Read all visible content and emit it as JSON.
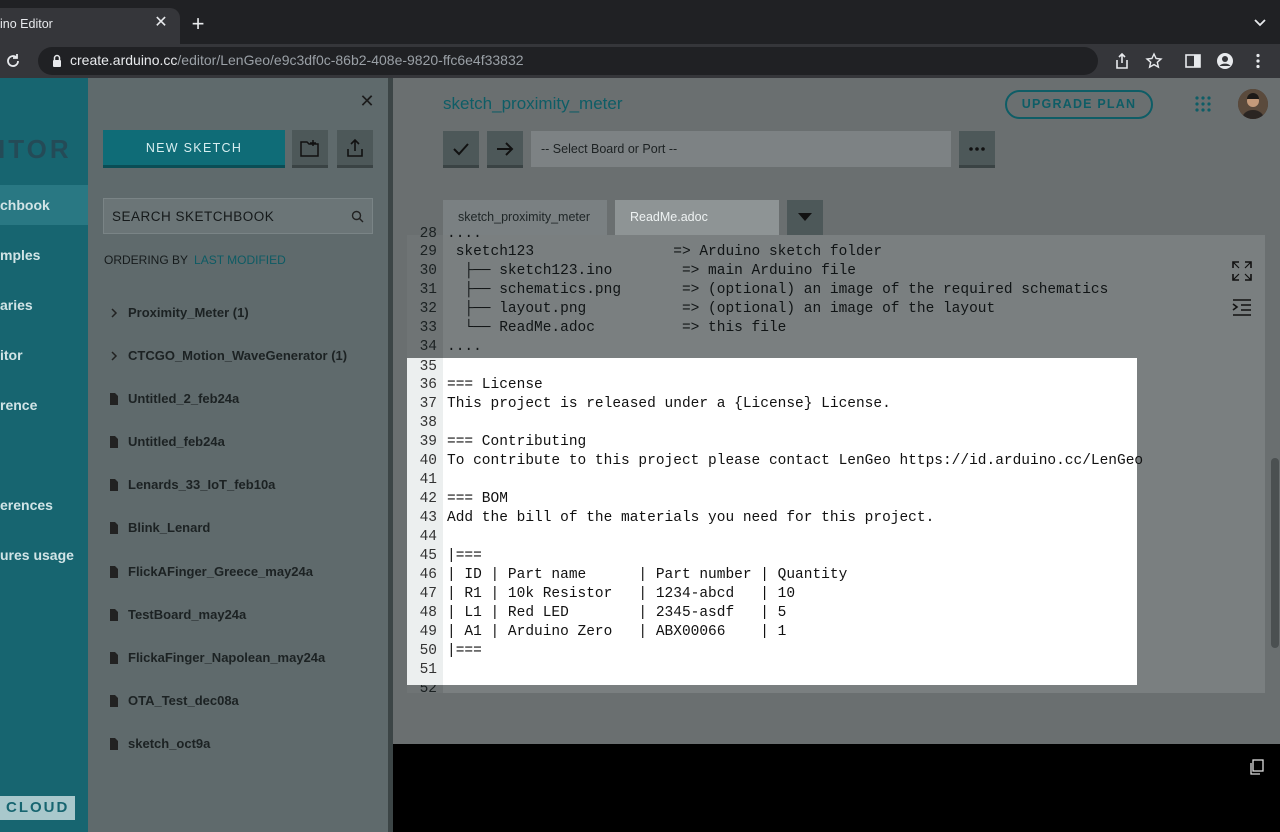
{
  "browser": {
    "tab_title": "ino Editor",
    "url_host": "create.arduino.cc",
    "url_path": "/editor/LenGeo/e9c3df0c-86b2-408e-9820-ffc6e4f33832"
  },
  "leftnav": {
    "brand": "ITOR",
    "items": [
      {
        "label": "chbook"
      },
      {
        "label": "mples"
      },
      {
        "label": "aries"
      },
      {
        "label": "itor"
      },
      {
        "label": "rence"
      },
      {
        "label": "erences"
      },
      {
        "label": "ures usage"
      }
    ],
    "cloud": "CLOUD"
  },
  "sketchbook": {
    "new_sketch": "NEW SKETCH",
    "search_placeholder": "SEARCH SKETCHBOOK",
    "ordering_label": "ORDERING BY",
    "ordering_value": "LAST MODIFIED",
    "items": [
      {
        "label": "Proximity_Meter (1)",
        "type": "folder"
      },
      {
        "label": "CTCGO_Motion_WaveGenerator (1)",
        "type": "folder"
      },
      {
        "label": "Untitled_2_feb24a",
        "type": "sketch"
      },
      {
        "label": "Untitled_feb24a",
        "type": "sketch"
      },
      {
        "label": "Lenards_33_IoT_feb10a",
        "type": "sketch"
      },
      {
        "label": "Blink_Lenard",
        "type": "sketch"
      },
      {
        "label": "FlickAFinger_Greece_may24a",
        "type": "sketch"
      },
      {
        "label": "TestBoard_may24a",
        "type": "sketch"
      },
      {
        "label": "FlickaFinger_Napolean_may24a",
        "type": "sketch"
      },
      {
        "label": "OTA_Test_dec08a",
        "type": "sketch"
      },
      {
        "label": "sketch_oct9a",
        "type": "sketch"
      }
    ]
  },
  "editor": {
    "sketch_title": "sketch_proximity_meter",
    "upgrade": "UPGRADE PLAN",
    "board_placeholder": "-- Select Board or Port --",
    "tabs": [
      "sketch_proximity_meter",
      "ReadMe.adoc"
    ],
    "dim_lines": [
      {
        "n": "28",
        "text": "...."
      },
      {
        "n": "29",
        "text": " sketch123                => Arduino sketch folder"
      },
      {
        "n": "30",
        "text": "  ├── sketch123.ino        => main Arduino file"
      },
      {
        "n": "31",
        "text": "  ├── schematics.png       => (optional) an image of the required schematics"
      },
      {
        "n": "32",
        "text": "  ├── layout.png           => (optional) an image of the layout"
      },
      {
        "n": "33",
        "text": "  └── ReadMe.adoc          => this file"
      },
      {
        "n": "34",
        "text": "...."
      }
    ],
    "focus_lines": [
      {
        "n": "35",
        "text": ""
      },
      {
        "n": "36",
        "text": "=== License"
      },
      {
        "n": "37",
        "text": "This project is released under a {License} License."
      },
      {
        "n": "38",
        "text": ""
      },
      {
        "n": "39",
        "text": "=== Contributing"
      },
      {
        "n": "40",
        "text": "To contribute to this project please contact LenGeo https://id.arduino.cc/LenGeo"
      },
      {
        "n": "41",
        "text": ""
      },
      {
        "n": "42",
        "text": "=== BOM"
      },
      {
        "n": "43",
        "text": "Add the bill of the materials you need for this project."
      },
      {
        "n": "44",
        "text": ""
      },
      {
        "n": "45",
        "text": "|==="
      },
      {
        "n": "46",
        "text": "| ID | Part name      | Part number | Quantity"
      },
      {
        "n": "47",
        "text": "| R1 | 10k Resistor   | 1234-abcd   | 10"
      },
      {
        "n": "48",
        "text": "| L1 | Red LED        | 2345-asdf   | 5"
      },
      {
        "n": "49",
        "text": "| A1 | Arduino Zero   | ABX00066    | 1"
      },
      {
        "n": "50",
        "text": "|==="
      },
      {
        "n": "51",
        "text": ""
      }
    ],
    "last_line_number": "52"
  },
  "icons": {
    "reload": "reload-icon",
    "lock": "lock-icon",
    "share": "share-icon",
    "star": "star-icon",
    "sidepanel": "side-panel-icon",
    "profile": "profile-icon",
    "menu": "kebab-menu-icon",
    "new_folder": "new-folder-icon",
    "upload": "upload-icon",
    "verify": "check-icon",
    "upload_sketch": "arrow-right-icon",
    "more": "more-icon",
    "expand": "expand-icon",
    "indent": "indent-icon",
    "copy": "copy-icon",
    "apps": "apps-grid-icon"
  }
}
